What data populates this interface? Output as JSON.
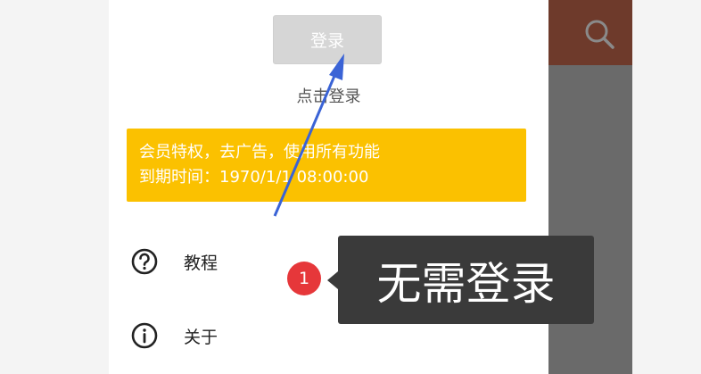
{
  "drawer": {
    "login_button": "登录",
    "login_hint": "点击登录",
    "vip_banner": {
      "line1": "会员特权，去广告，使用所有功能",
      "line2": "到期时间：1970/1/1 08:00:00"
    },
    "menu": [
      {
        "label": "教程",
        "icon": "question-circle-icon"
      },
      {
        "label": "关于",
        "icon": "info-circle-icon"
      }
    ]
  },
  "annotation": {
    "step_number": "1",
    "tooltip_text": "无需登录",
    "arrow_color": "#3a63d6",
    "badge_color": "#e6373a"
  },
  "colors": {
    "appbar": "#6e3a2b",
    "vip_banner": "#fbc100",
    "login_button": "#d6d6d6"
  }
}
